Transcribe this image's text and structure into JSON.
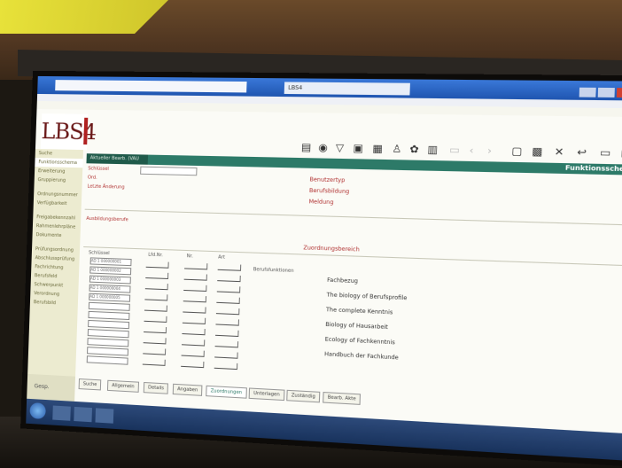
{
  "app": {
    "logo": "LBS4",
    "module_title": "Aktueller Bearb. (VAU 80)",
    "section_title": "Funktionsschema"
  },
  "browser": {
    "tab_title": "LBS4"
  },
  "sidebar": {
    "items": [
      {
        "label": "Suche"
      },
      {
        "label": "Funktionsschema"
      },
      {
        "label": "Erweiterung"
      },
      {
        "label": "Gruppierung"
      },
      {
        "label": "Ordnungsnummer"
      },
      {
        "label": "Verfügbarkeit"
      },
      {
        "label": "Freigabekennzahl"
      },
      {
        "label": "Rahmenlehrpläne"
      },
      {
        "label": "Dokumente"
      },
      {
        "label": "Prüfungsordnung"
      },
      {
        "label": "Abschlussprüfung"
      },
      {
        "label": "Fachrichtung"
      },
      {
        "label": "Berufsfeld"
      },
      {
        "label": "Schwerpunkt"
      },
      {
        "label": "Verordnung"
      },
      {
        "label": "Berufsbild"
      }
    ]
  },
  "form": {
    "field1_label": "Schlüssel",
    "field2_label": "Ord.",
    "field3_label": "Letzte Änderung",
    "right_label1": "Benutzertyp",
    "right_label2": "Berufsbildung",
    "right_label3": "Meldung",
    "mid_label": "Ausbildungsberufe",
    "section_red": "Zuordnungsbereich",
    "col_headers": [
      "Schlüssel",
      "Lfd.Nr.",
      "Nr.",
      "Art"
    ],
    "rows": [
      "AD 1 000000001",
      "AD 1 000000002",
      "AD 1 000000003",
      "AD 1 000000004",
      "AD 1 000000005",
      "",
      "",
      "",
      "",
      "",
      "",
      ""
    ],
    "list_header": "Berufsfunktionen",
    "list_col": "Fachbezug",
    "list_items": [
      "The biology of Berufsprofile",
      "The complete Kenntnis",
      "Biology of Hausarbeit",
      "Ecology of Fachkenntnis",
      "Handbuch der Fachkunde"
    ]
  },
  "tabs": [
    {
      "label": "Suche"
    },
    {
      "label": "Allgemein"
    },
    {
      "label": "Details"
    },
    {
      "label": "Angaben"
    },
    {
      "label": "Zuordnungen"
    },
    {
      "label": "Unterlagen"
    },
    {
      "label": "Zuständig"
    },
    {
      "label": "Bearb. Akte"
    }
  ],
  "footer": {
    "label": "Gesp."
  }
}
